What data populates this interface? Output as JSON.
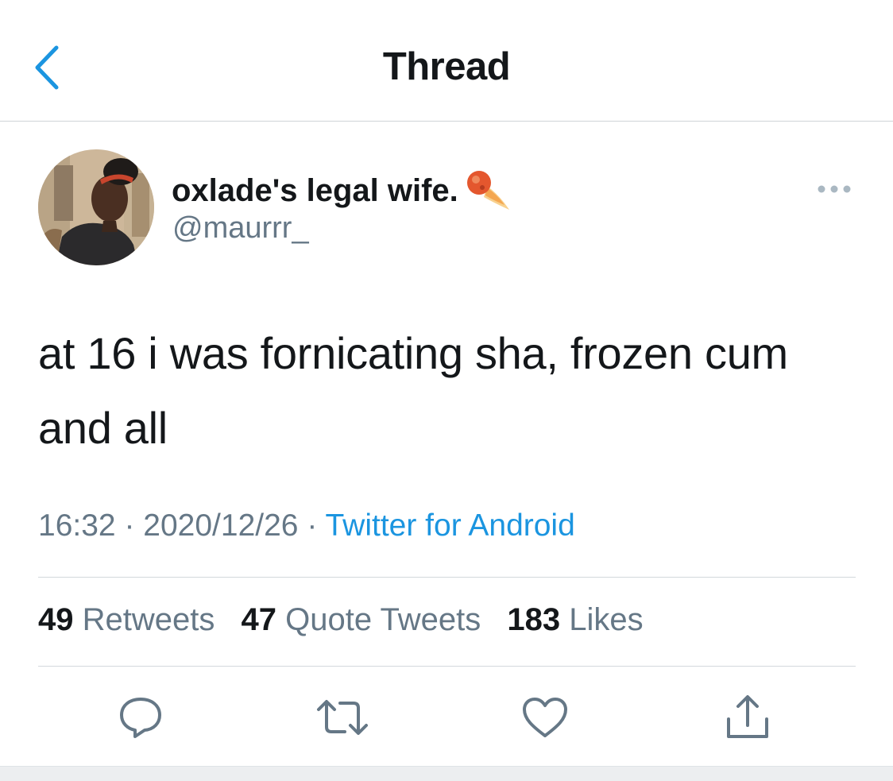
{
  "header": {
    "title": "Thread",
    "back_icon": "chevron-left-icon"
  },
  "tweet": {
    "author": {
      "name": "oxlade's legal wife.",
      "handle": "@maurrr_",
      "name_emoji_icon": "comet-icon"
    },
    "text": "at 16 i was fornicating sha, frozen cum and all",
    "time": "16:32",
    "date": "2020/12/26",
    "separator": "·",
    "source": "Twitter for Android",
    "stats": {
      "retweets_count": "49",
      "retweets_label": "Retweets",
      "quotes_count": "47",
      "quotes_label": "Quote Tweets",
      "likes_count": "183",
      "likes_label": "Likes"
    }
  },
  "actions": [
    "reply-icon",
    "retweet-icon",
    "like-icon",
    "share-icon"
  ],
  "colors": {
    "accent": "#1b95e0",
    "text_primary": "#14171a",
    "text_secondary": "#657786",
    "divider": "#d3d8dc"
  }
}
